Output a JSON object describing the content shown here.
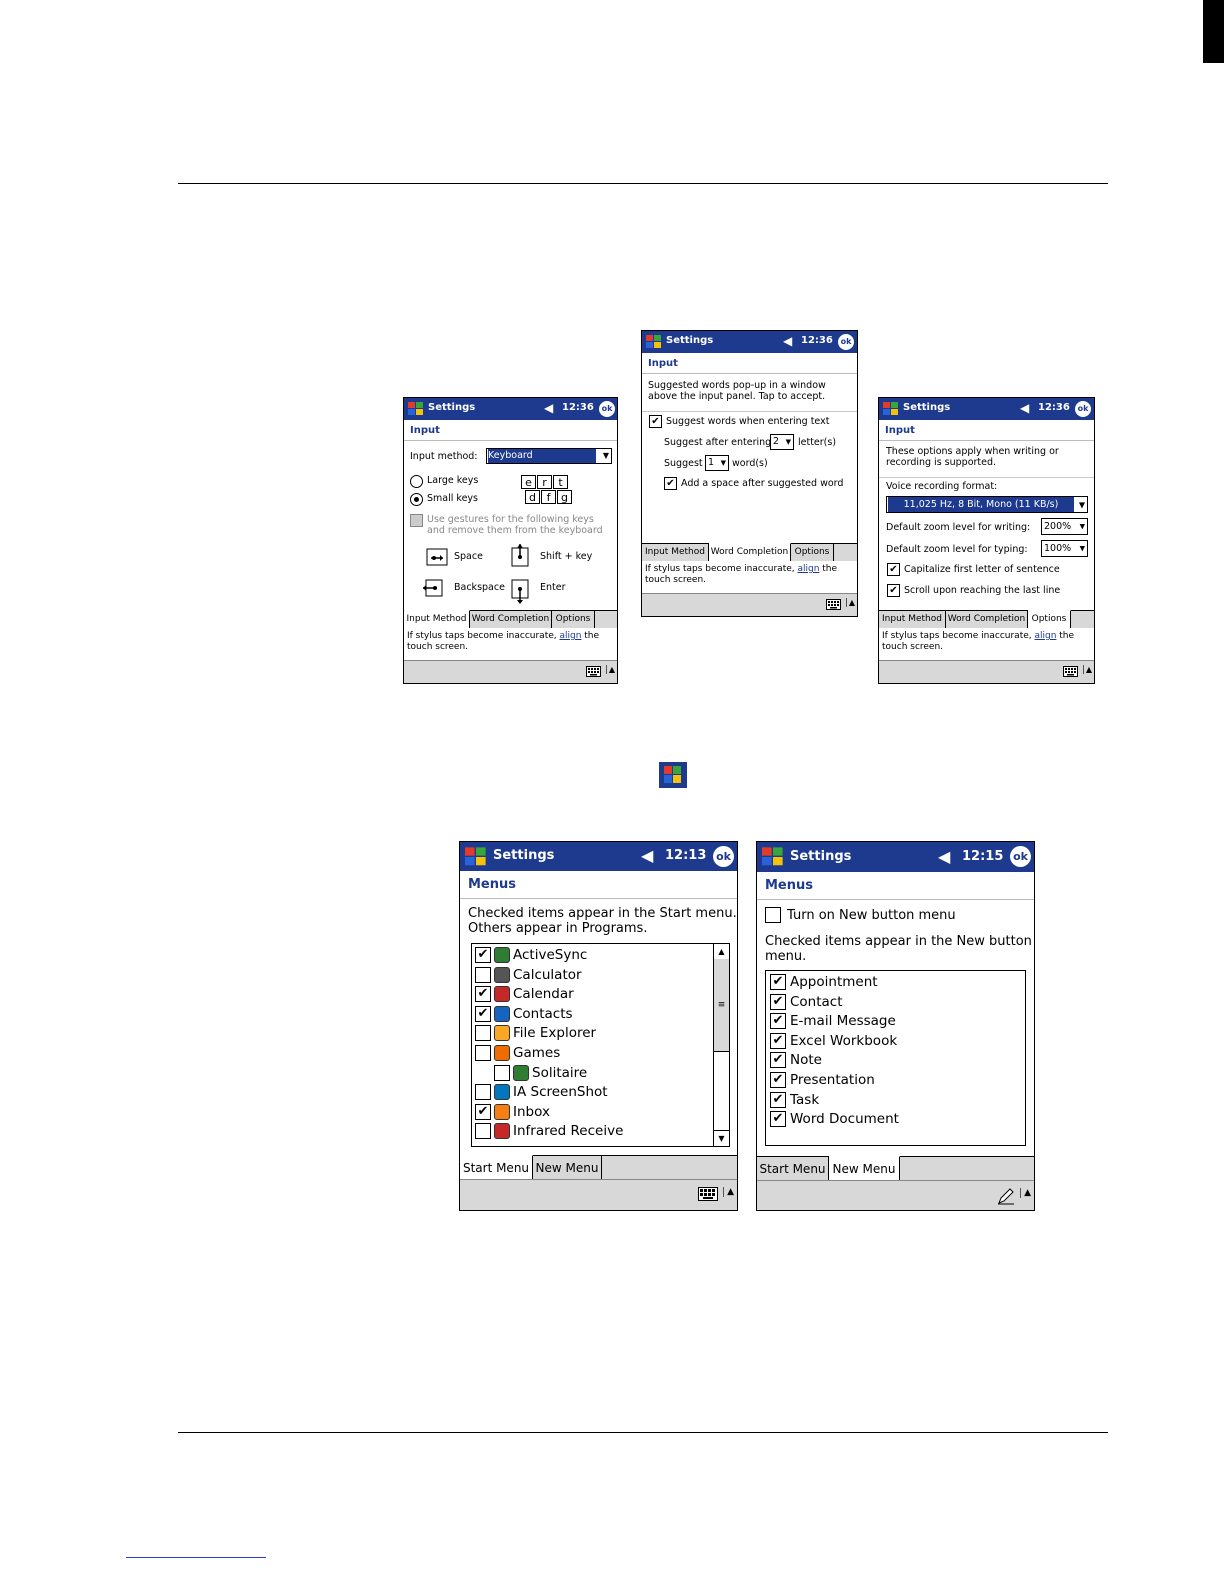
{
  "screens": {
    "common": {
      "settings": "Settings",
      "ok": "ok",
      "input": "Input",
      "menus": "Menus",
      "align_pre": "If stylus taps become inaccurate, ",
      "align_link": "align",
      "align_post": " the",
      "touch_screen": "touch screen."
    },
    "input_method": {
      "time": "12:36",
      "method_label": "Input method:",
      "method_value": "Keyboard",
      "large_keys": "Large keys",
      "small_keys": "Small keys",
      "keys_row1": [
        "e",
        "r",
        "t"
      ],
      "keys_row2": [
        "d",
        "f",
        "g"
      ],
      "gestures_text": "Use gestures for the following keys and remove them from the keyboard",
      "space": "Space",
      "shift": "Shift + key",
      "backspace": "Backspace",
      "enter": "Enter",
      "tabs": [
        "Input Method",
        "Word Completion",
        "Options"
      ]
    },
    "word_completion": {
      "time": "12:36",
      "desc": "Suggested words pop-up in a window above the input panel.  Tap to accept.",
      "suggest_words": "Suggest words when entering text",
      "suggest_after": "Suggest after entering",
      "after_value": "2",
      "letters": "letter(s)",
      "suggest": "Suggest",
      "suggest_value": "1",
      "words": "word(s)",
      "add_space": "Add a space after suggested word",
      "tabs": [
        "Input Method",
        "Word Completion",
        "Options"
      ]
    },
    "options": {
      "time": "12:36",
      "desc": "These options apply when writing or recording is supported.",
      "voice_label": "Voice recording format:",
      "voice_value": "11,025 Hz, 8 Bit, Mono (11 KB/s)",
      "zoom_writing": "Default zoom level for writing:",
      "zoom_writing_value": "200%",
      "zoom_typing": "Default zoom level for typing:",
      "zoom_typing_value": "100%",
      "capitalize": "Capitalize first letter of sentence",
      "scroll": "Scroll upon reaching the last line",
      "tabs": [
        "Input Method",
        "Word Completion",
        "Options"
      ]
    },
    "start_menu": {
      "time": "12:13",
      "desc1": "Checked items appear in the Start menu.",
      "desc2": "Others appear in Programs.",
      "items": [
        {
          "label": "ActiveSync",
          "checked": true
        },
        {
          "label": "Calculator",
          "checked": false
        },
        {
          "label": "Calendar",
          "checked": true
        },
        {
          "label": "Contacts",
          "checked": true
        },
        {
          "label": "File Explorer",
          "checked": false
        },
        {
          "label": "Games",
          "checked": false
        },
        {
          "label": "Solitaire",
          "checked": false
        },
        {
          "label": "IA ScreenShot",
          "checked": false
        },
        {
          "label": "Inbox",
          "checked": true
        },
        {
          "label": "Infrared Receive",
          "checked": false
        }
      ],
      "tabs": [
        "Start Menu",
        "New Menu"
      ]
    },
    "new_menu": {
      "time": "12:15",
      "turn_on": "Turn on New button menu",
      "desc1": "Checked items appear in the New button",
      "desc2": "menu.",
      "items": [
        "Appointment",
        "Contact",
        "E-mail Message",
        "Excel Workbook",
        "Note",
        "Presentation",
        "Task",
        "Word Document"
      ],
      "tabs": [
        "Start Menu",
        "New Menu"
      ]
    }
  }
}
